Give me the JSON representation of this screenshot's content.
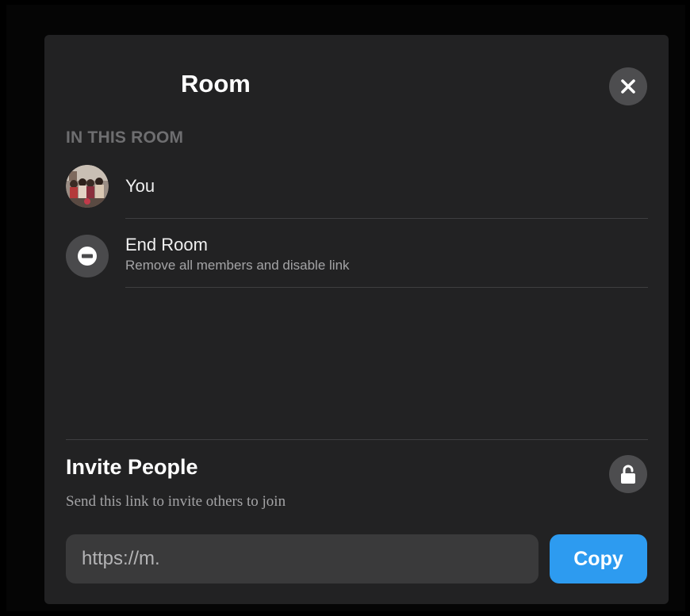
{
  "room": {
    "title": "Room",
    "section_label": "IN THIS ROOM",
    "members": [
      {
        "name": "You",
        "avatar": "group-photo-avatar"
      }
    ],
    "end_room": {
      "title": "End Room",
      "subtitle": "Remove all members and disable link",
      "icon": "minus-circle-icon"
    },
    "close_icon": "close-icon"
  },
  "invite": {
    "title": "Invite People",
    "subtitle": "Send this link to invite others to join",
    "link_value": "https://m.",
    "copy_label": "Copy",
    "lock_icon": "lock-icon"
  },
  "colors": {
    "panel_bg": "#222223",
    "accent": "#2d9bf0",
    "icon_circle": "#4d4d4f",
    "input_bg": "#3a3a3b"
  }
}
